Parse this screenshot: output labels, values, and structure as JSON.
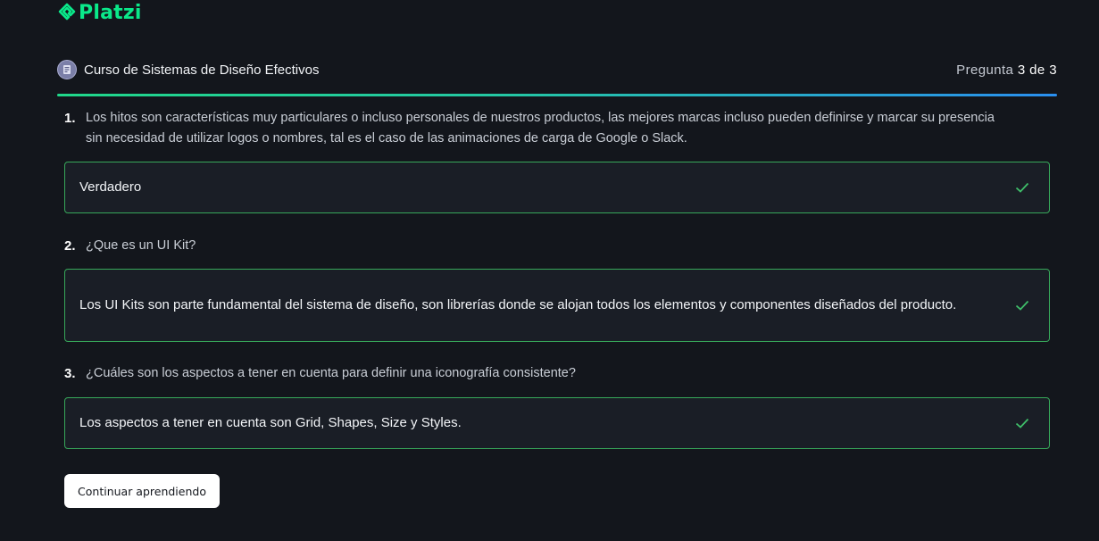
{
  "brand": {
    "name": "Platzi",
    "color": "#0ae98a"
  },
  "header": {
    "course_title": "Curso de Sistemas de Diseño Efectivos",
    "course_icon": "course-badge-icon",
    "counter_prefix": "Pregunta",
    "counter_current": "3",
    "counter_of": "de",
    "counter_total": "3"
  },
  "progress": {
    "fraction": 1.0
  },
  "questions": [
    {
      "number": "1.",
      "text": "Los hitos son características muy particulares o incluso personales de nuestros productos, las mejores marcas incluso pueden definirse y marcar su presencia sin necesidad de utilizar logos o nombres, tal es el caso de las animaciones de carga de Google o Slack.",
      "answer": "Verdadero",
      "answer_icon": "check-icon"
    },
    {
      "number": "2.",
      "text": "¿Que es un UI Kit?",
      "answer": "Los UI Kits son parte fundamental del sistema de diseño, son librerías donde se alojan todos los elementos y componentes diseñados del producto.",
      "answer_icon": "check-icon"
    },
    {
      "number": "3.",
      "text": "¿Cuáles son los aspectos a tener en cuenta para definir una iconografía consistente?",
      "answer": "Los aspectos a tener en cuenta son Grid, Shapes, Size y Styles.",
      "answer_icon": "check-icon"
    }
  ],
  "actions": {
    "continue_label": "Continuar aprendiendo"
  },
  "colors": {
    "background": "#13161c",
    "correct_border": "#37a85a",
    "check": "#3fbf6a",
    "progress_start": "#20d88a",
    "progress_end": "#2a8ff0"
  }
}
